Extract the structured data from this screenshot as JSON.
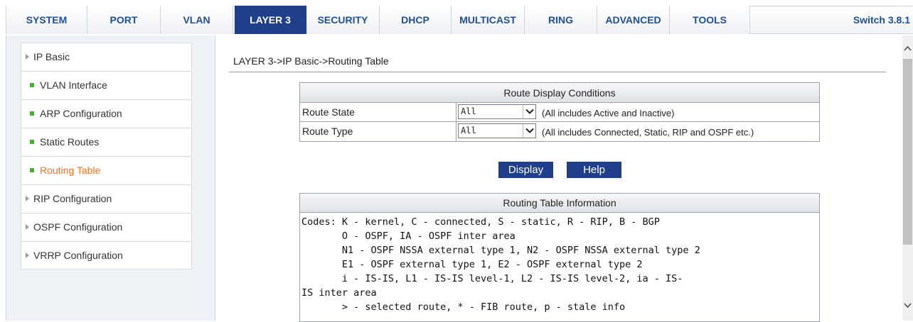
{
  "tabs": [
    {
      "label": "SYSTEM"
    },
    {
      "label": "PORT"
    },
    {
      "label": "VLAN"
    },
    {
      "label": "LAYER 3"
    },
    {
      "label": "SECURITY"
    },
    {
      "label": "DHCP"
    },
    {
      "label": "MULTICAST"
    },
    {
      "label": "RING"
    },
    {
      "label": "ADVANCED"
    },
    {
      "label": "TOOLS"
    }
  ],
  "active_tab": "LAYER 3",
  "version": "Switch 3.8.1",
  "sidebar": {
    "items": [
      {
        "label": "IP Basic",
        "icon": "caret-right-icon"
      },
      {
        "label": "VLAN Interface",
        "icon": "green-square-bullet"
      },
      {
        "label": "ARP Configuration",
        "icon": "green-square-bullet"
      },
      {
        "label": "Static Routes",
        "icon": "green-square-bullet"
      },
      {
        "label": "Routing Table",
        "icon": "green-square-bullet"
      },
      {
        "label": "RIP Configuration",
        "icon": "caret-right-icon"
      },
      {
        "label": "OSPF Configuration",
        "icon": "caret-right-icon"
      },
      {
        "label": "VRRP Configuration",
        "icon": "caret-right-icon"
      }
    ]
  },
  "main": {
    "breadcrumb": "LAYER 3->IP Basic->Routing Table",
    "conditions": {
      "header": "Route Display Conditions",
      "rows": [
        {
          "label": "Route State",
          "value": "All",
          "note": "(All includes Active and Inactive)"
        },
        {
          "label": "Route Type",
          "value": "All",
          "note": "(All includes Connected, Static, RIP and OSPF etc.)"
        }
      ]
    },
    "buttons": {
      "display": "Display",
      "help": "Help"
    },
    "info": {
      "header": "Routing Table Information",
      "text": "Codes: K - kernel, C - connected, S - static, R - RIP, B - BGP\n       O - OSPF, IA - OSPF inter area\n       N1 - OSPF NSSA external type 1, N2 - OSPF NSSA external type 2\n       E1 - OSPF external type 1, E2 - OSPF external type 2\n       i - IS-IS, L1 - IS-IS level-1, L2 - IS-IS level-2, ia - IS-\nIS inter area\n       > - selected route, * - FIB route, p - stale info"
    }
  },
  "colors": {
    "accent": "#1f3f8a",
    "tab_text": "#214f95",
    "current_item": "#f07321",
    "bullet": "#4caf2a"
  }
}
